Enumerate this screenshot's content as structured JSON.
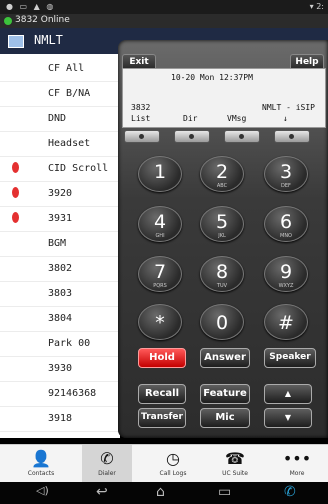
{
  "status": {
    "left_icons": "● ▭ ▲ ◍",
    "right": "▾ 2:"
  },
  "notification": {
    "text": "3832 Online"
  },
  "header": {
    "title": "NMLT"
  },
  "line_keys": [
    {
      "label": "CF All",
      "led": false
    },
    {
      "label": "CF B/NA",
      "led": false
    },
    {
      "label": "DND",
      "led": false
    },
    {
      "label": "Headset",
      "led": false
    },
    {
      "label": "CID Scroll",
      "led": true
    },
    {
      "label": "3920",
      "led": true
    },
    {
      "label": "3931",
      "led": true
    },
    {
      "label": "BGM",
      "led": false
    },
    {
      "label": "3802",
      "led": false
    },
    {
      "label": "3803",
      "led": false
    },
    {
      "label": "3804",
      "led": false
    },
    {
      "label": "Park 00",
      "led": false
    },
    {
      "label": "3930",
      "led": false
    },
    {
      "label": "92146368",
      "led": false
    },
    {
      "label": "3918",
      "led": false
    }
  ],
  "phone": {
    "exit_label": "Exit",
    "help_label": "Help",
    "lcd": {
      "datetime": "10-20 Mon 12:37PM",
      "extension": "3832",
      "line_name": "NMLT - iSIP",
      "softkeys": [
        "List",
        "Dir",
        "VMsg",
        "↓"
      ]
    },
    "digits": [
      {
        "n": "1",
        "s": ""
      },
      {
        "n": "2",
        "s": "ABC"
      },
      {
        "n": "3",
        "s": "DEF"
      },
      {
        "n": "4",
        "s": "GHI"
      },
      {
        "n": "5",
        "s": "JKL"
      },
      {
        "n": "6",
        "s": "MNO"
      },
      {
        "n": "7",
        "s": "PQRS"
      },
      {
        "n": "8",
        "s": "TUV"
      },
      {
        "n": "9",
        "s": "WXYZ"
      },
      {
        "n": "*",
        "s": ""
      },
      {
        "n": "0",
        "s": ""
      },
      {
        "n": "#",
        "s": ""
      }
    ],
    "function_buttons": {
      "hold": "Hold",
      "answer": "Answer",
      "speaker": "Speaker",
      "recall": "Recall",
      "feature": "Feature",
      "up": "▲",
      "transfer": "Transfer",
      "mic": "Mic",
      "down": "▼"
    },
    "colors": {
      "hold": "#e01010"
    }
  },
  "tabs": [
    {
      "label": "Contacts",
      "icon": "person-icon",
      "glyph": "👤"
    },
    {
      "label": "Dialer",
      "icon": "handset-icon",
      "glyph": "✆"
    },
    {
      "label": "Call Logs",
      "icon": "clock-icon",
      "glyph": "◷"
    },
    {
      "label": "UC Suite",
      "icon": "uc-icon",
      "glyph": "☎"
    },
    {
      "label": "More",
      "icon": "more-icon",
      "glyph": "•••"
    }
  ],
  "system_nav": {
    "volume_down": "◁)",
    "back": "↩",
    "home": "⌂",
    "recents": "▭",
    "phone": "✆"
  }
}
